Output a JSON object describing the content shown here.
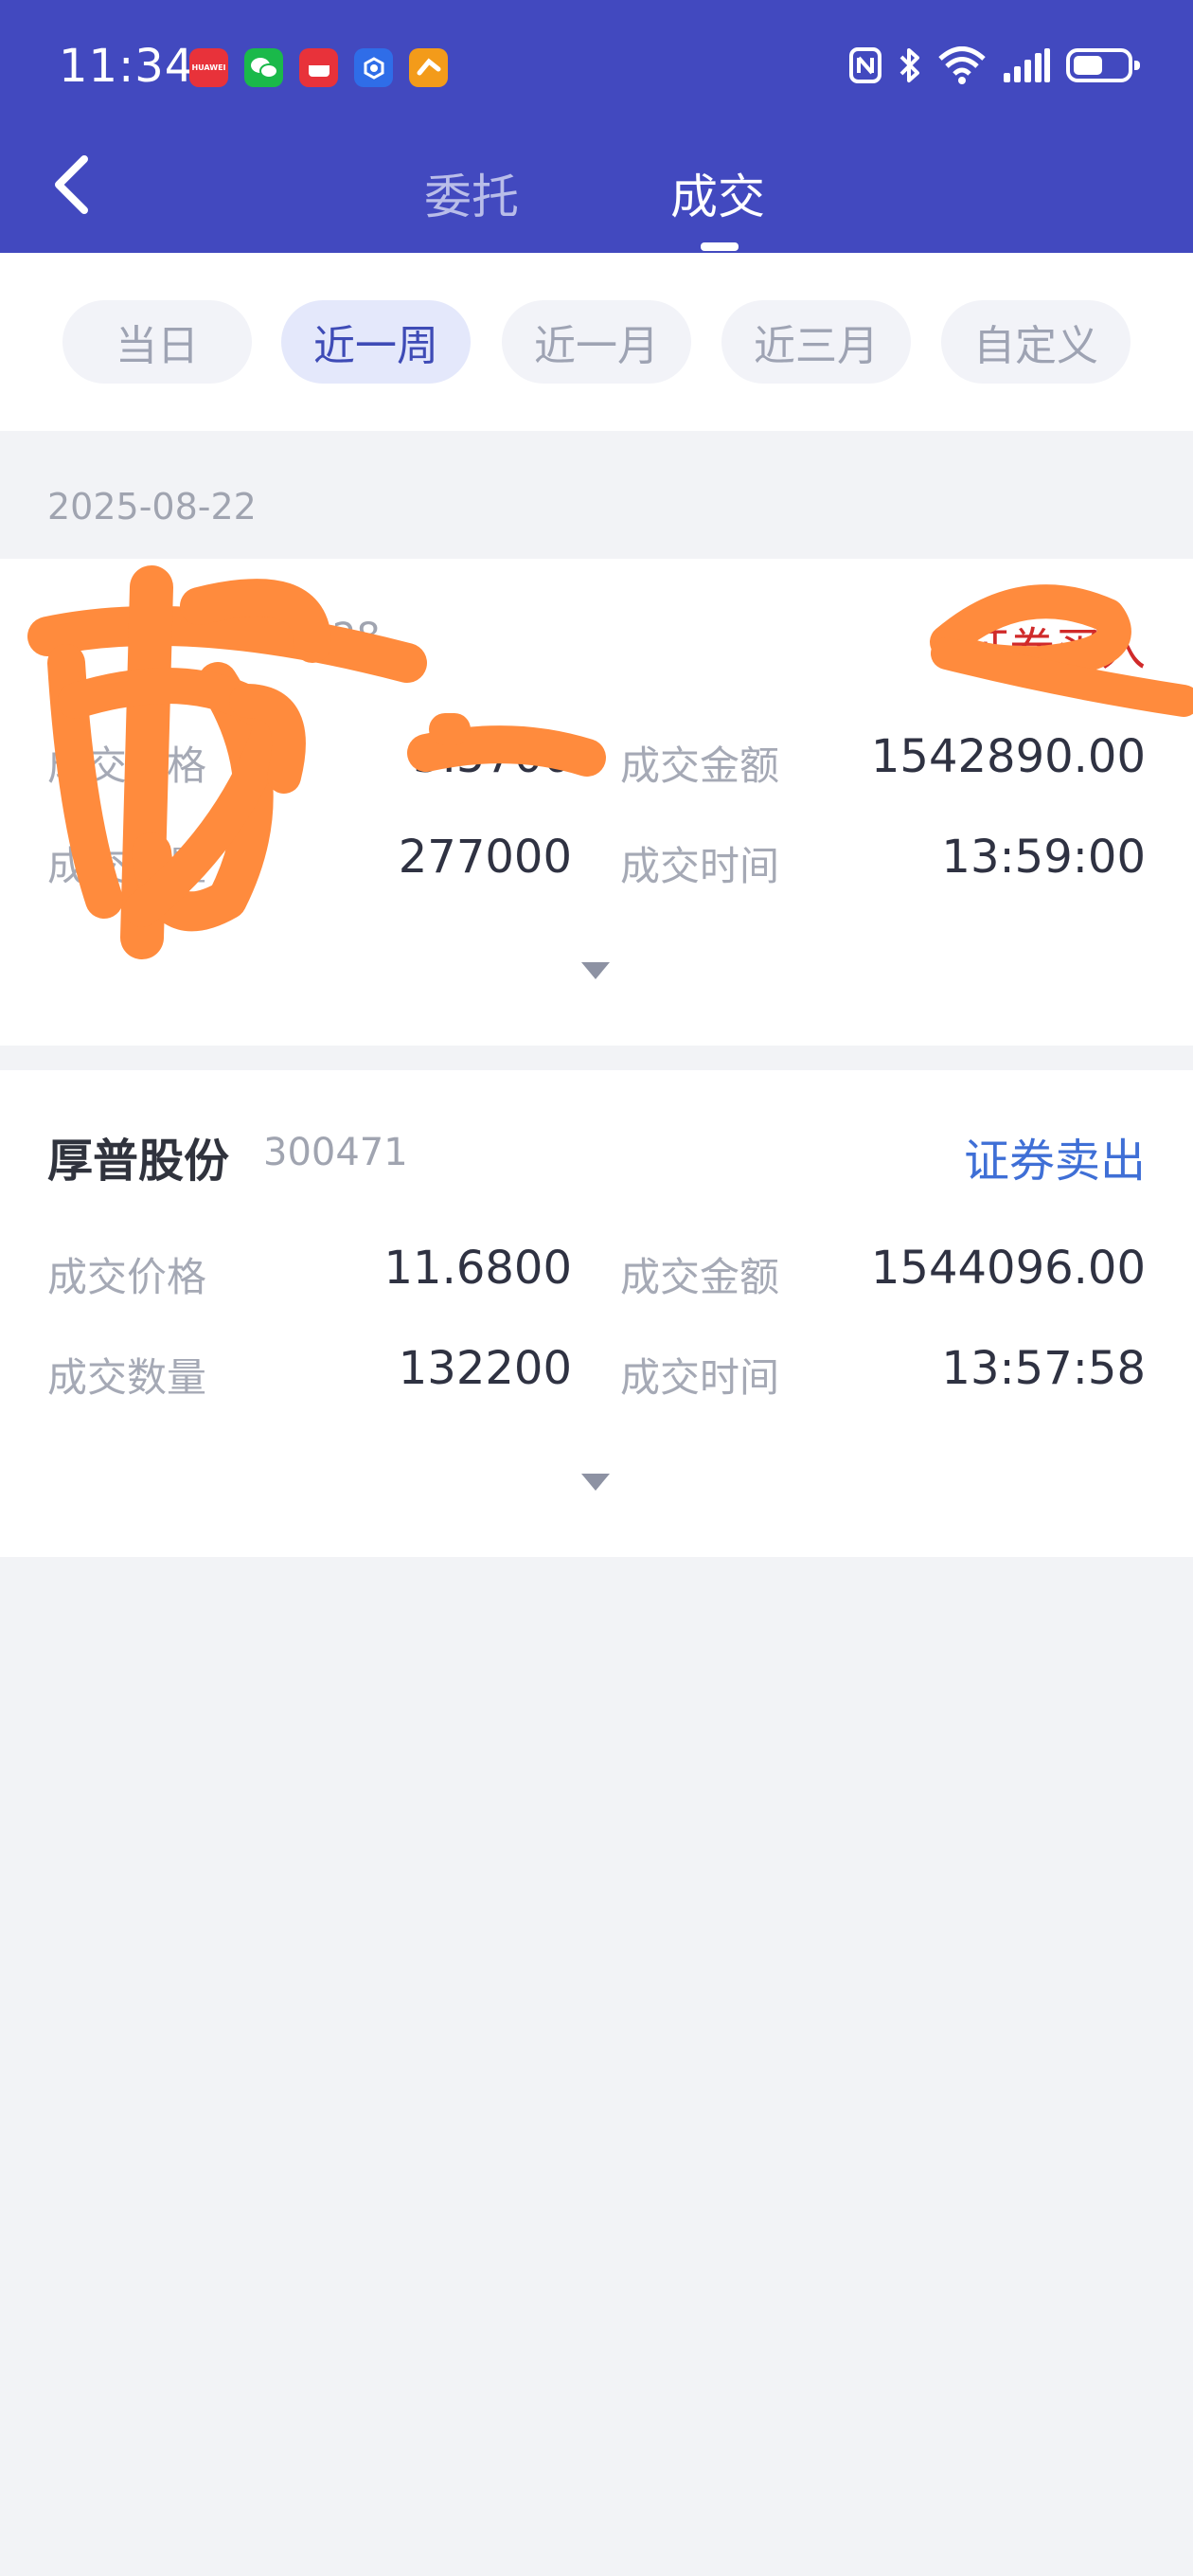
{
  "status": {
    "time": "11:34",
    "apps": [
      {
        "name": "huawei-app-icon",
        "label": "HUAWEI",
        "color": "#e8323a"
      },
      {
        "name": "wechat-icon",
        "label": "",
        "color": "#1ab94a"
      },
      {
        "name": "red-app-icon",
        "label": "",
        "color": "#e8323a"
      },
      {
        "name": "blue-app-icon",
        "label": "",
        "color": "#2f6de8"
      },
      {
        "name": "orange-app-icon",
        "label": "",
        "color": "#f39b1a"
      }
    ],
    "icons": [
      "nfc-icon",
      "bluetooth-icon",
      "wifi-icon",
      "signal-icon",
      "battery-icon"
    ]
  },
  "nav": {
    "tabs": [
      "委托",
      "成交"
    ],
    "active_tab": "成交"
  },
  "filters": {
    "chips": [
      "当日",
      "近一周",
      "近一月",
      "近三月",
      "自定义"
    ],
    "selected": "近一周"
  },
  "date_group": "2025-08-22",
  "labels": {
    "price": "成交价格",
    "amount": "成交金额",
    "quantity": "成交数量",
    "time": "成交时间"
  },
  "trades": [
    {
      "name": "",
      "code": "…3428",
      "type": "证券买入",
      "type_color": "#d02a2a",
      "price": "5.5700",
      "amount": "1542890.00",
      "quantity": "277000",
      "time": "13:59:00"
    },
    {
      "name": "厚普股份",
      "code": "300471",
      "type": "证券卖出",
      "type_color": "#3f6fd6",
      "price": "11.6800",
      "amount": "1544096.00",
      "quantity": "132200",
      "time": "13:57:58"
    }
  ],
  "colors": {
    "header": "#4249bf",
    "redaction": "#ff8b3d"
  }
}
